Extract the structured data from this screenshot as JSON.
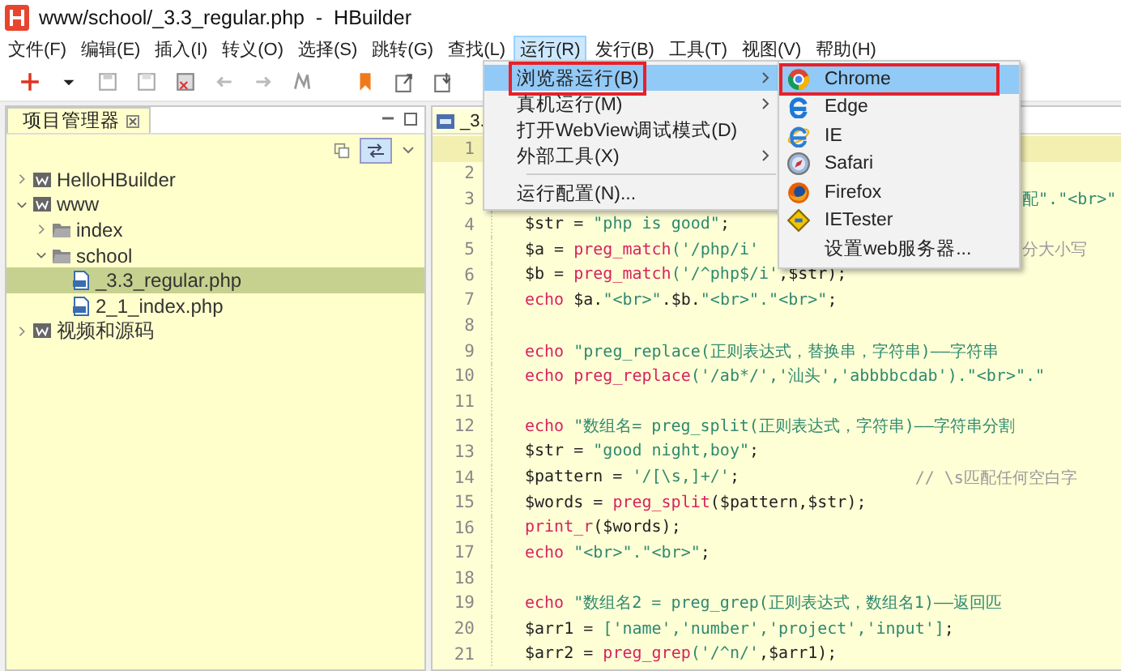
{
  "window": {
    "title": "www/school/_3.3_regular.php  -  HBuilder"
  },
  "menu_bar": [
    {
      "label": "文件(F)",
      "selected": false
    },
    {
      "label": "编辑(E)",
      "selected": false
    },
    {
      "label": "插入(I)",
      "selected": false
    },
    {
      "label": "转义(O)",
      "selected": false
    },
    {
      "label": "选择(S)",
      "selected": false
    },
    {
      "label": "跳转(G)",
      "selected": false
    },
    {
      "label": "查找(L)",
      "selected": false
    },
    {
      "label": "运行(R)",
      "selected": true
    },
    {
      "label": "发行(B)",
      "selected": false
    },
    {
      "label": "工具(T)",
      "selected": false
    },
    {
      "label": "视图(V)",
      "selected": false
    },
    {
      "label": "帮助(H)",
      "selected": false
    }
  ],
  "run_menu": [
    {
      "label": "浏览器运行(B)",
      "selected": true,
      "submenu": true,
      "marked": true,
      "separator_before": false
    },
    {
      "label": "真机运行(M)",
      "selected": false,
      "submenu": true,
      "marked": false,
      "separator_before": false
    },
    {
      "label": "打开WebView调试模式(D)",
      "selected": false,
      "submenu": false,
      "marked": false,
      "separator_before": false
    },
    {
      "label": "外部工具(X)",
      "selected": false,
      "submenu": true,
      "marked": false,
      "separator_before": false
    },
    {
      "label": "运行配置(N)...",
      "selected": false,
      "submenu": false,
      "marked": false,
      "separator_before": true
    }
  ],
  "browser_menu": [
    {
      "label": "Chrome",
      "selected": true,
      "marked": true
    },
    {
      "label": "Edge",
      "selected": false,
      "marked": false
    },
    {
      "label": "IE",
      "selected": false,
      "marked": false
    },
    {
      "label": "Safari",
      "selected": false,
      "marked": false
    },
    {
      "label": "Firefox",
      "selected": false,
      "marked": false
    },
    {
      "label": "IETester",
      "selected": false,
      "marked": false
    },
    {
      "label": "设置web服务器...",
      "selected": false,
      "marked": false
    }
  ],
  "project_panel": {
    "tab": "项目管理器",
    "tree": [
      {
        "label": "HelloHBuilder",
        "kind": "project",
        "expanded": false,
        "selected": false
      },
      {
        "label": "www",
        "kind": "project",
        "expanded": true,
        "selected": false,
        "children": [
          {
            "label": "index",
            "kind": "folder",
            "expanded": false,
            "selected": false
          },
          {
            "label": "school",
            "kind": "folder",
            "expanded": true,
            "selected": false,
            "children": [
              {
                "label": "_3.3_regular.php",
                "kind": "file",
                "selected": true
              },
              {
                "label": "2_1_index.php",
                "kind": "file",
                "selected": false
              }
            ]
          }
        ]
      },
      {
        "label": "视频和源码",
        "kind": "project",
        "expanded": false,
        "selected": false
      }
    ]
  },
  "editor": {
    "tab": "_3.",
    "lines": [
      {
        "number": "1",
        "current": true
      },
      {
        "number": "2",
        "current": false
      },
      {
        "number": "3",
        "current": false,
        "tail": {
          "text": "配\".\"<br>\"",
          "kind": "string"
        }
      },
      {
        "number": "4",
        "current": false,
        "segments": [
          {
            "text": "$str = ",
            "kind": "plain"
          },
          {
            "text": "\"php is good\"",
            "kind": "string"
          },
          {
            "text": ";",
            "kind": "plain"
          }
        ]
      },
      {
        "number": "5",
        "current": false,
        "segments": [
          {
            "text": "$a = ",
            "kind": "plain"
          },
          {
            "text": "preg_match",
            "kind": "keyword"
          },
          {
            "text": "('/php/i'",
            "kind": "string"
          }
        ],
        "tail": {
          "text": "分大小写",
          "kind": "comment"
        }
      },
      {
        "number": "6",
        "current": false,
        "segments": [
          {
            "text": "$b = ",
            "kind": "plain"
          },
          {
            "text": "preg_match",
            "kind": "keyword"
          },
          {
            "text": "('/^php$/i'",
            "kind": "string"
          },
          {
            "text": ",$str);",
            "kind": "plain"
          }
        ]
      },
      {
        "number": "7",
        "current": false,
        "segments": [
          {
            "text": "echo",
            "kind": "keyword"
          },
          {
            "text": " $a.",
            "kind": "plain"
          },
          {
            "text": "\"<br>\"",
            "kind": "string"
          },
          {
            "text": ".$b.",
            "kind": "plain"
          },
          {
            "text": "\"<br>\".\"<br>\"",
            "kind": "string"
          },
          {
            "text": ";",
            "kind": "plain"
          }
        ]
      },
      {
        "number": "8",
        "current": false
      },
      {
        "number": "9",
        "current": false,
        "segments": [
          {
            "text": "echo",
            "kind": "keyword"
          },
          {
            "text": " \"preg_replace(正则表达式，替换串，字符串)——字符串",
            "kind": "string"
          }
        ]
      },
      {
        "number": "10",
        "current": false,
        "segments": [
          {
            "text": "echo ",
            "kind": "keyword"
          },
          {
            "text": "preg_replace",
            "kind": "keyword"
          },
          {
            "text": "('/ab*/','汕头','abbbbcdab').\"<br>\".\"",
            "kind": "string"
          }
        ]
      },
      {
        "number": "11",
        "current": false
      },
      {
        "number": "12",
        "current": false,
        "segments": [
          {
            "text": "echo",
            "kind": "keyword"
          },
          {
            "text": " \"数组名= preg_split(正则表达式，字符串)——字符串分割",
            "kind": "string"
          }
        ]
      },
      {
        "number": "13",
        "current": false,
        "segments": [
          {
            "text": "$str = ",
            "kind": "plain"
          },
          {
            "text": "\"good night,boy\"",
            "kind": "string"
          },
          {
            "text": ";",
            "kind": "plain"
          }
        ]
      },
      {
        "number": "14",
        "current": false,
        "segments": [
          {
            "text": "$pattern = ",
            "kind": "plain"
          },
          {
            "text": "'/[\\s,]+/'",
            "kind": "string"
          },
          {
            "text": ";",
            "kind": "plain"
          }
        ],
        "tail": {
          "text": "// \\s匹配任何空白字",
          "kind": "comment"
        }
      },
      {
        "number": "15",
        "current": false,
        "segments": [
          {
            "text": "$words = ",
            "kind": "plain"
          },
          {
            "text": "preg_split",
            "kind": "keyword"
          },
          {
            "text": "($pattern,$str);",
            "kind": "plain"
          }
        ]
      },
      {
        "number": "16",
        "current": false,
        "segments": [
          {
            "text": "print_r",
            "kind": "keyword"
          },
          {
            "text": "($words);",
            "kind": "plain"
          }
        ]
      },
      {
        "number": "17",
        "current": false,
        "segments": [
          {
            "text": "echo",
            "kind": "keyword"
          },
          {
            "text": " \"<br>\".\"<br>\"",
            "kind": "string"
          },
          {
            "text": ";",
            "kind": "plain"
          }
        ]
      },
      {
        "number": "18",
        "current": false
      },
      {
        "number": "19",
        "current": false,
        "segments": [
          {
            "text": "echo",
            "kind": "keyword"
          },
          {
            "text": " \"数组名2 = preg_grep(正则表达式，数组名1)——返回匹",
            "kind": "string"
          }
        ]
      },
      {
        "number": "20",
        "current": false,
        "segments": [
          {
            "text": "$arr1 = ",
            "kind": "plain"
          },
          {
            "text": "['name','number','project','input']",
            "kind": "string"
          },
          {
            "text": ";",
            "kind": "plain"
          }
        ]
      },
      {
        "number": "21",
        "current": false,
        "segments": [
          {
            "text": "$arr2 = ",
            "kind": "plain"
          },
          {
            "text": "preg_grep",
            "kind": "keyword"
          },
          {
            "text": "('/^n/'",
            "kind": "string"
          },
          {
            "text": ",$arr1);",
            "kind": "plain"
          }
        ]
      }
    ]
  }
}
